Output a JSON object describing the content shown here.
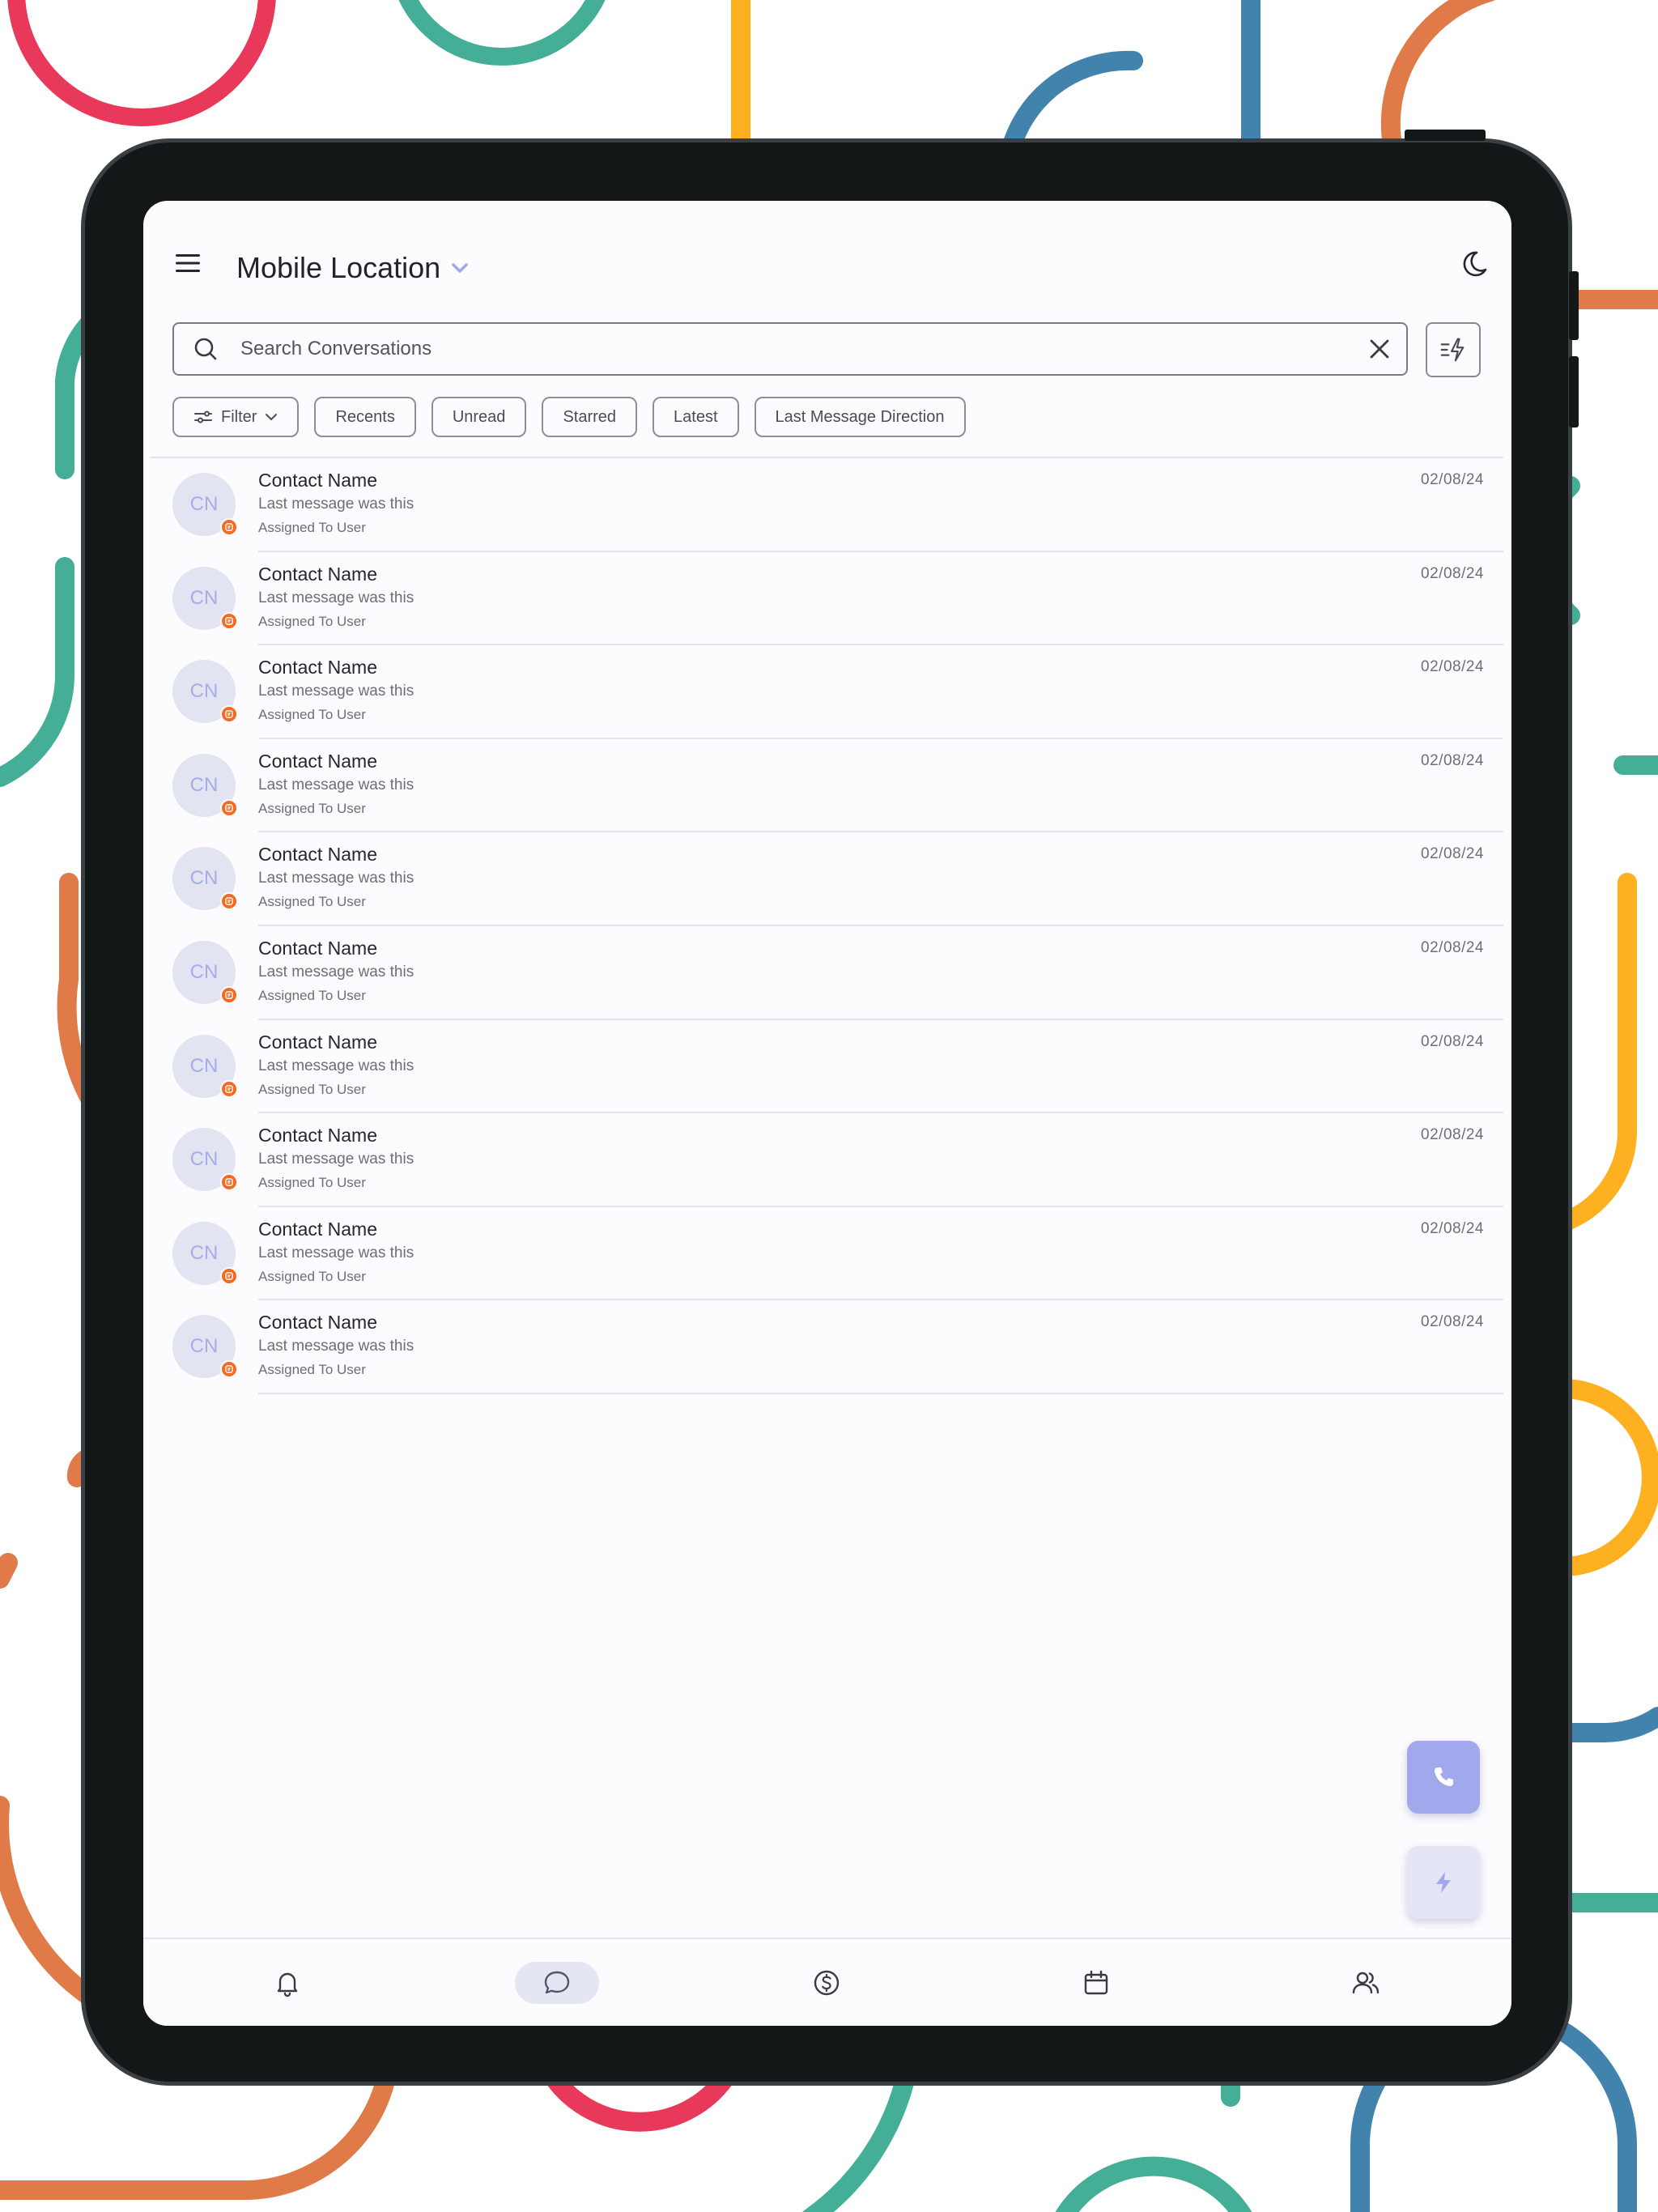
{
  "header": {
    "location_name": "Mobile Location"
  },
  "search": {
    "placeholder": "Search Conversations"
  },
  "filters": {
    "filter_label": "Filter",
    "chips": [
      "Recents",
      "Unread",
      "Starred",
      "Latest",
      "Last Message Direction"
    ]
  },
  "conversations": [
    {
      "initials": "CN",
      "name": "Contact Name",
      "last_message": "Last message was this",
      "assigned": "Assigned To User",
      "date": "02/08/24"
    },
    {
      "initials": "CN",
      "name": "Contact Name",
      "last_message": "Last message was this",
      "assigned": "Assigned To User",
      "date": "02/08/24"
    },
    {
      "initials": "CN",
      "name": "Contact Name",
      "last_message": "Last message was this",
      "assigned": "Assigned To User",
      "date": "02/08/24"
    },
    {
      "initials": "CN",
      "name": "Contact Name",
      "last_message": "Last message was this",
      "assigned": "Assigned To User",
      "date": "02/08/24"
    },
    {
      "initials": "CN",
      "name": "Contact Name",
      "last_message": "Last message was this",
      "assigned": "Assigned To User",
      "date": "02/08/24"
    },
    {
      "initials": "CN",
      "name": "Contact Name",
      "last_message": "Last message was this",
      "assigned": "Assigned To User",
      "date": "02/08/24"
    },
    {
      "initials": "CN",
      "name": "Contact Name",
      "last_message": "Last message was this",
      "assigned": "Assigned To User",
      "date": "02/08/24"
    },
    {
      "initials": "CN",
      "name": "Contact Name",
      "last_message": "Last message was this",
      "assigned": "Assigned To User",
      "date": "02/08/24"
    },
    {
      "initials": "CN",
      "name": "Contact Name",
      "last_message": "Last message was this",
      "assigned": "Assigned To User",
      "date": "02/08/24"
    },
    {
      "initials": "CN",
      "name": "Contact Name",
      "last_message": "Last message was this",
      "assigned": "Assigned To User",
      "date": "02/08/24"
    }
  ],
  "icons": {
    "menu": "hamburger-menu-icon",
    "location_dropdown": "chevron-down-icon",
    "theme": "moon-icon",
    "search": "search-icon",
    "clear": "close-icon",
    "quick_actions": "lightning-filter-icon",
    "filter": "sliders-icon",
    "channel_badge": "message-badge-icon",
    "fab_call": "phone-icon",
    "fab_quick": "lightning-icon",
    "nav": [
      "bell-icon",
      "chat-bubble-icon",
      "dollar-icon",
      "calendar-icon",
      "users-icon"
    ]
  },
  "bottom_nav": {
    "active": "conversations"
  },
  "colors": {
    "accent": "#a1a8ec",
    "avatar_bg": "#e3e4f1",
    "avatar_text": "#a5adea",
    "badge": "#f36b22",
    "screen_bg": "#fcfbfe",
    "device_frame": "#131718"
  }
}
